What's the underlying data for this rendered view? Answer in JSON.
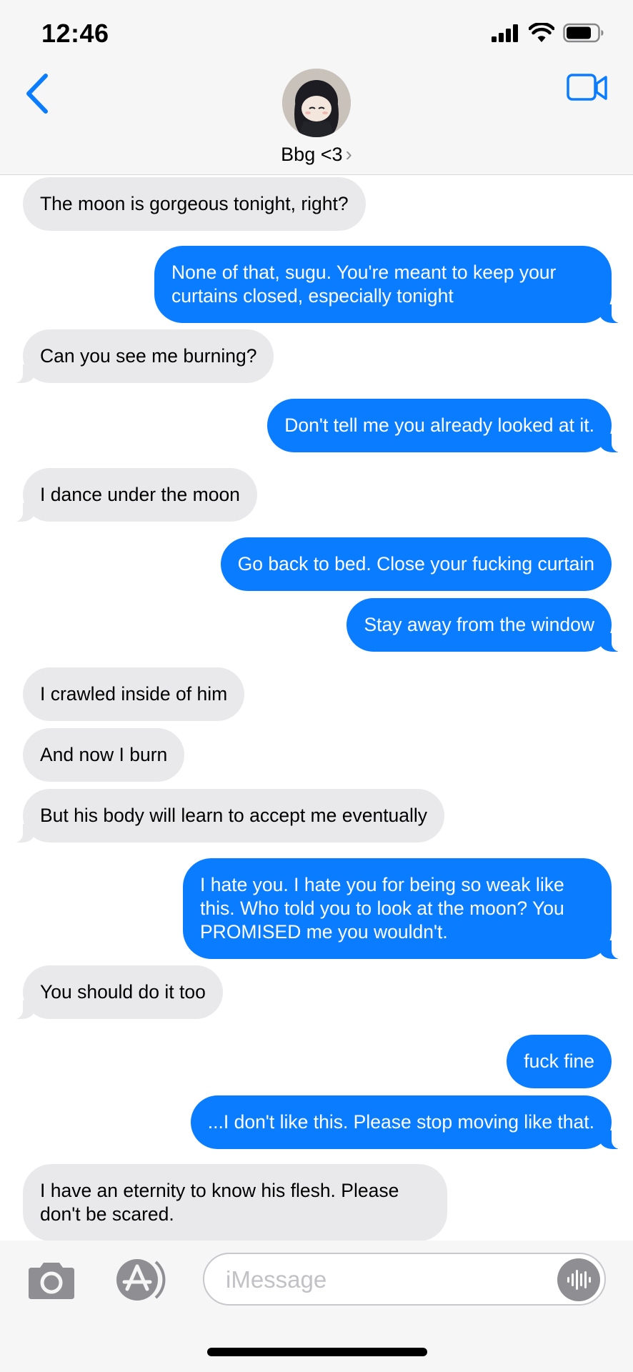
{
  "status_bar": {
    "time": "12:46"
  },
  "header": {
    "contact_name": "Bbg <3",
    "chevron": "›",
    "back_icon": "chevron-left-icon",
    "video_icon": "video-camera-icon"
  },
  "colors": {
    "sent_bubble": "#0a7cff",
    "received_bubble": "#e9e9eb",
    "accent": "#0a7cff"
  },
  "messages": [
    {
      "dir": "recv",
      "text": "The moon is gorgeous tonight, right?"
    },
    {
      "dir": "sent",
      "text": "None of that, sugu. You're meant to keep your curtains closed, especially tonight"
    },
    {
      "dir": "recv",
      "text": "Can you see me burning?"
    },
    {
      "dir": "sent",
      "text": "Don't tell me you already looked at it."
    },
    {
      "dir": "recv",
      "text": "I dance under the moon"
    },
    {
      "dir": "sent",
      "text": "Go back to bed. Close your fucking curtain"
    },
    {
      "dir": "sent",
      "text": "Stay away from the window"
    },
    {
      "dir": "recv",
      "text": "I crawled inside of him"
    },
    {
      "dir": "recv",
      "text": "And now I burn"
    },
    {
      "dir": "recv",
      "text": "But his body will learn to accept me eventually"
    },
    {
      "dir": "sent",
      "text": "I hate you. I hate you for being so weak like this. Who told you to look at the moon? You PROMISED me you wouldn't."
    },
    {
      "dir": "recv",
      "text": "You should do it too"
    },
    {
      "dir": "sent",
      "text": "fuck fine"
    },
    {
      "dir": "sent",
      "text": "...I don't like this. Please stop moving like that."
    },
    {
      "dir": "recv",
      "text": "I have an eternity to know his flesh. Please don't be scared."
    }
  ],
  "input_bar": {
    "placeholder": "iMessage",
    "camera_icon": "camera-icon",
    "apps_icon": "app-store-icon",
    "audio_icon": "audio-waveform-icon"
  }
}
